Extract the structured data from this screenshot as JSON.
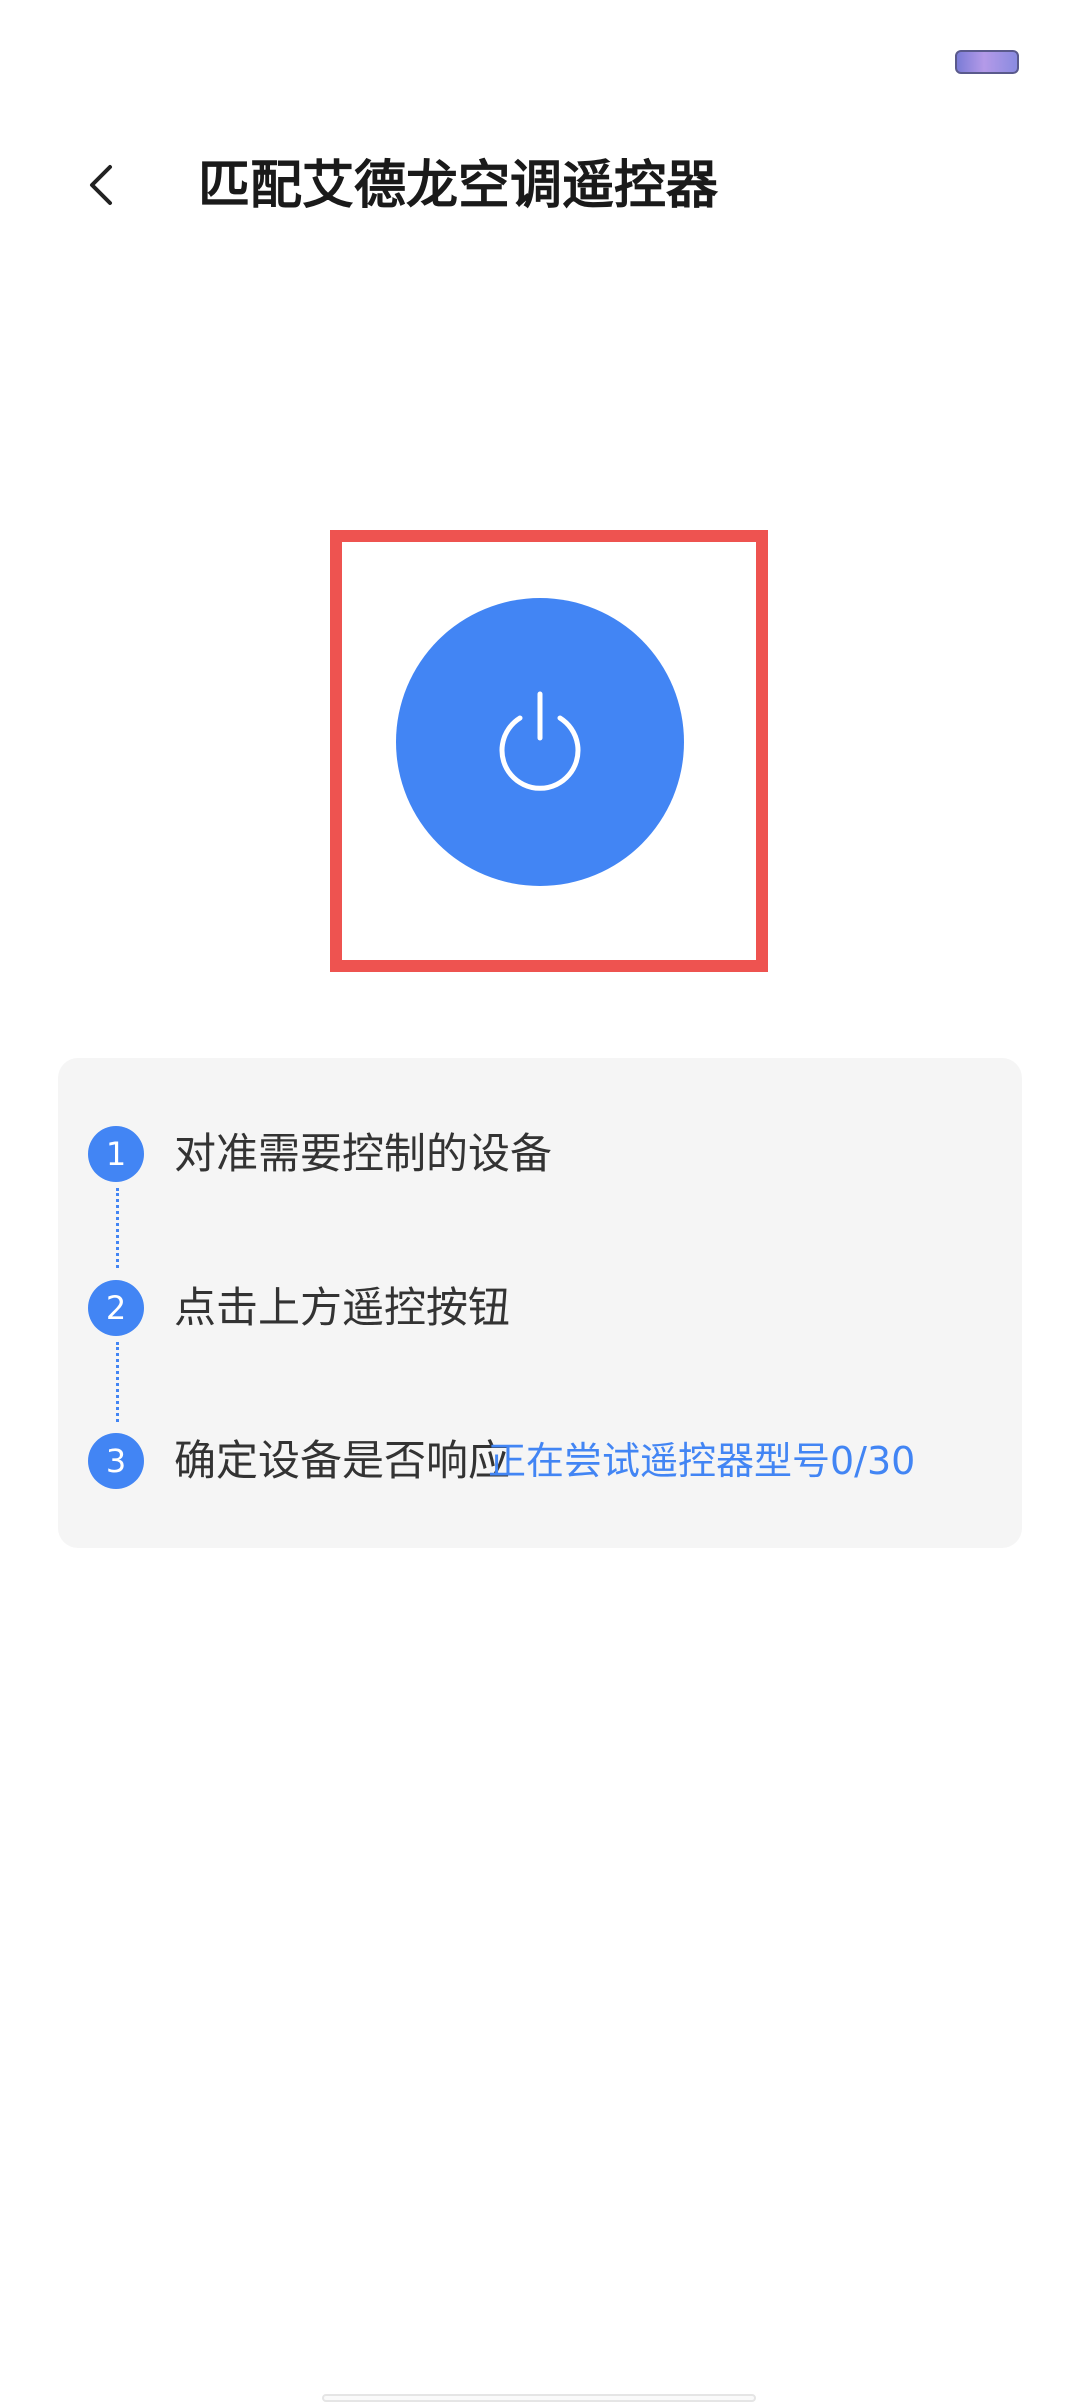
{
  "header": {
    "back_icon": "chevron-left-icon",
    "title": "匹配艾德龙空调遥控器"
  },
  "remote": {
    "power_icon": "power-icon",
    "accent_color": "#4285f4",
    "highlight_color": "#ee5350"
  },
  "steps": [
    {
      "number": "1",
      "text": "对准需要控制的设备"
    },
    {
      "number": "2",
      "text": "点击上方遥控按钮"
    },
    {
      "number": "3",
      "text": "确定设备是否响应"
    }
  ],
  "progress": {
    "text": "正在尝试遥控器型号0/30"
  }
}
